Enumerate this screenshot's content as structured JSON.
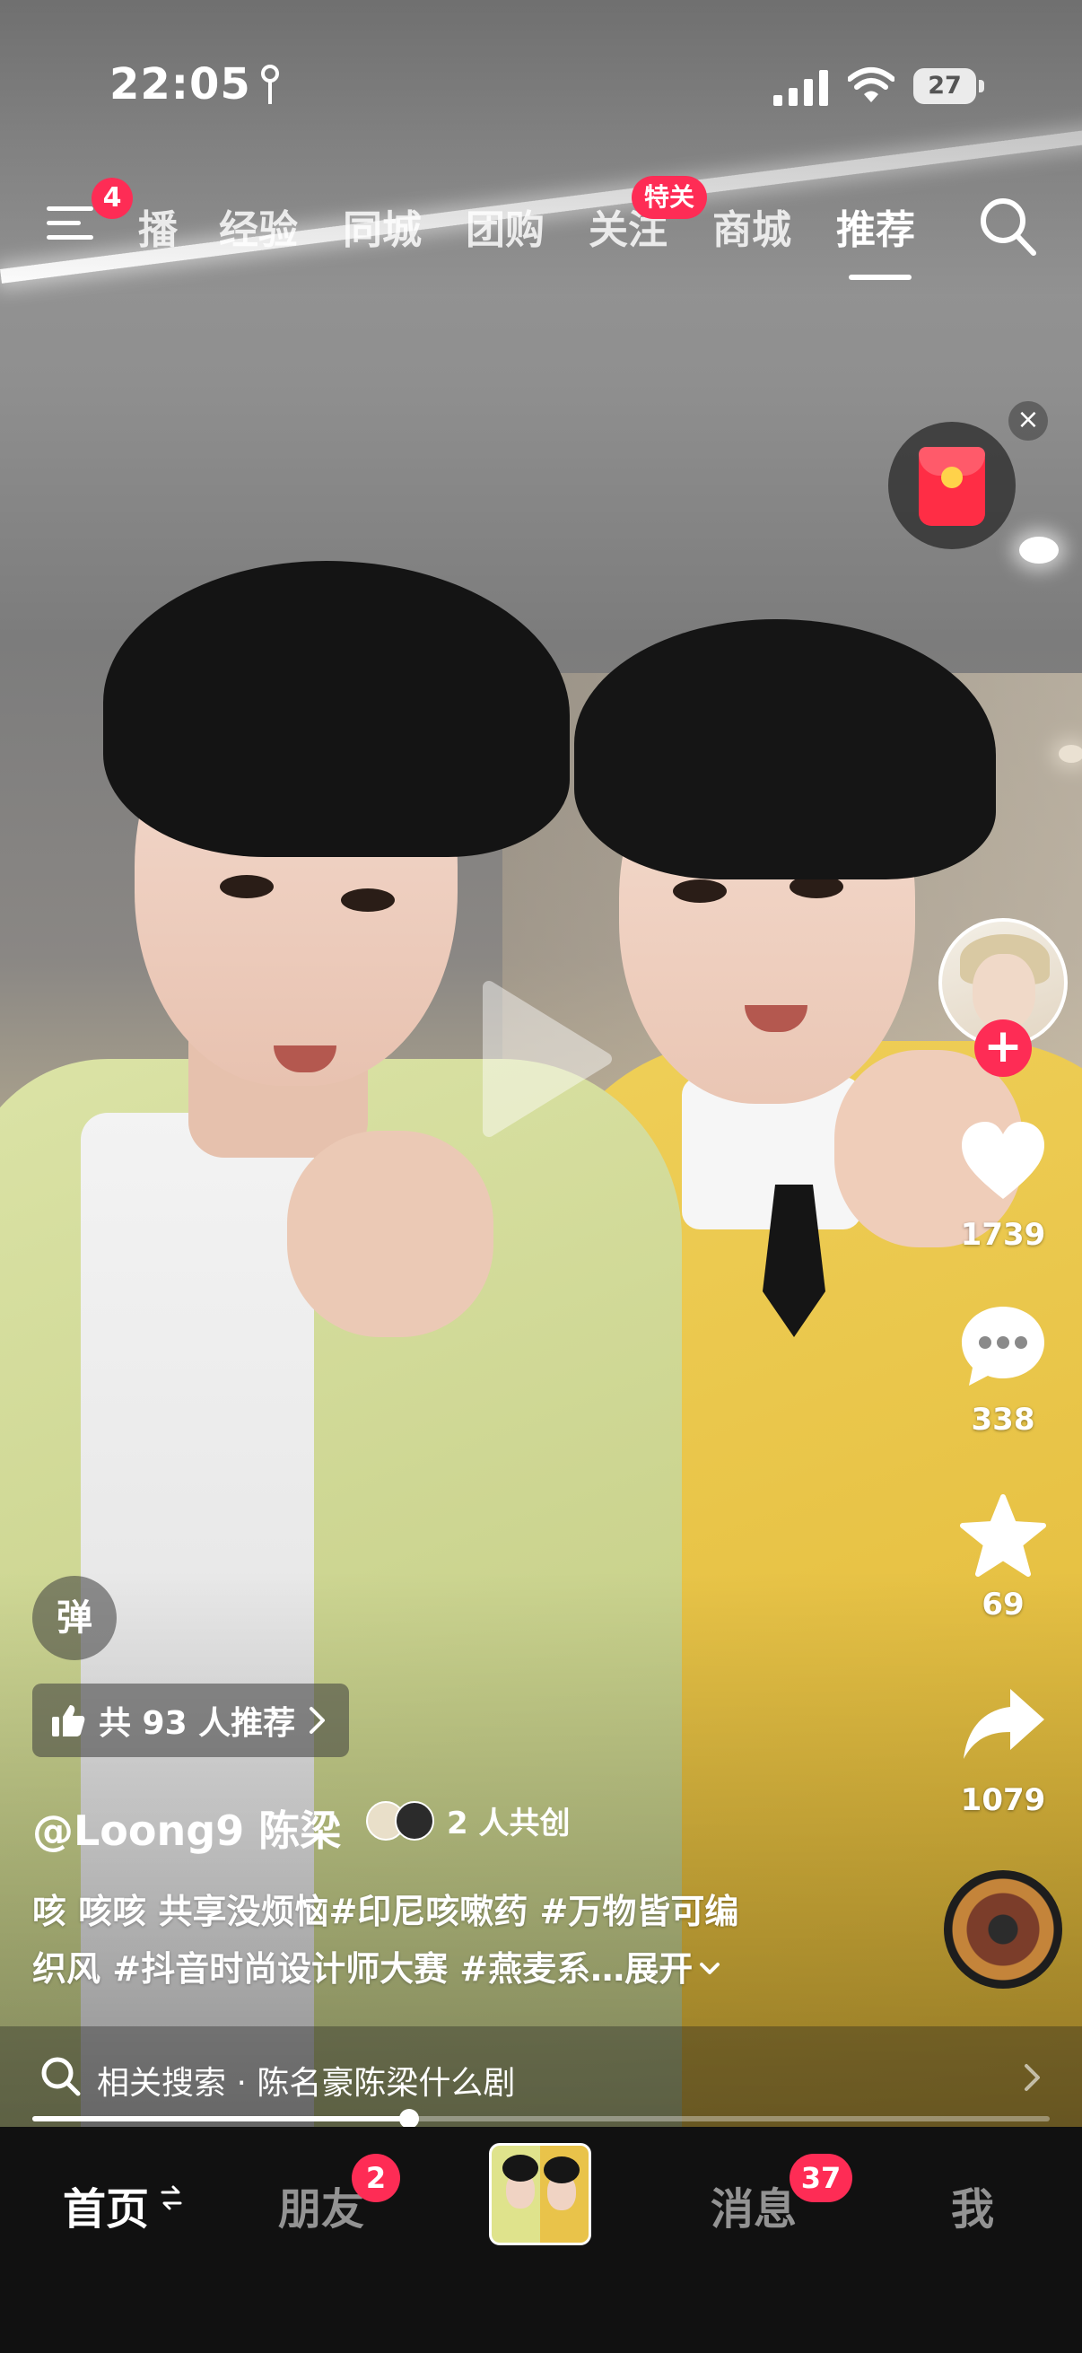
{
  "status_bar": {
    "time": "22:05",
    "battery_level": "27",
    "icons": [
      "location-arrow-icon",
      "signal-icon",
      "wifi-icon",
      "battery-icon"
    ]
  },
  "top_nav": {
    "menu_badge": "4",
    "tabs": [
      {
        "label": "播",
        "active": false
      },
      {
        "label": "经验",
        "active": false
      },
      {
        "label": "同城",
        "active": false
      },
      {
        "label": "团购",
        "active": false
      },
      {
        "label": "关注",
        "active": false,
        "tag": "特关"
      },
      {
        "label": "商城",
        "active": false
      },
      {
        "label": "推荐",
        "active": true
      }
    ]
  },
  "red_packet": {
    "close": "×"
  },
  "right_rail": {
    "follow": "+",
    "likes": "1739",
    "comments": "338",
    "favorites": "69",
    "shares": "1079"
  },
  "overlay": {
    "danmu_button": "弹",
    "recommend_pill": "共 93 人推荐",
    "author": "@Loong9 陈梁",
    "cocreate": "2 人共创",
    "caption_line1": "咳 咳咳 共享没烦恼#印尼咳嗽药 #万物皆可编",
    "caption_line2": "织风 #抖音时尚设计师大赛 #燕麦系…",
    "expand": "展开",
    "related_search": "相关搜索 · 陈名豪陈梁什么剧",
    "progress": 0.37
  },
  "bottom_tabs": {
    "home": "首页",
    "friends": "朋友",
    "friends_badge": "2",
    "messages": "消息",
    "messages_badge": "37",
    "me": "我"
  },
  "colors": {
    "accent": "#fe2c55",
    "tabbar_bg": "#111111",
    "text": "#ffffff"
  }
}
